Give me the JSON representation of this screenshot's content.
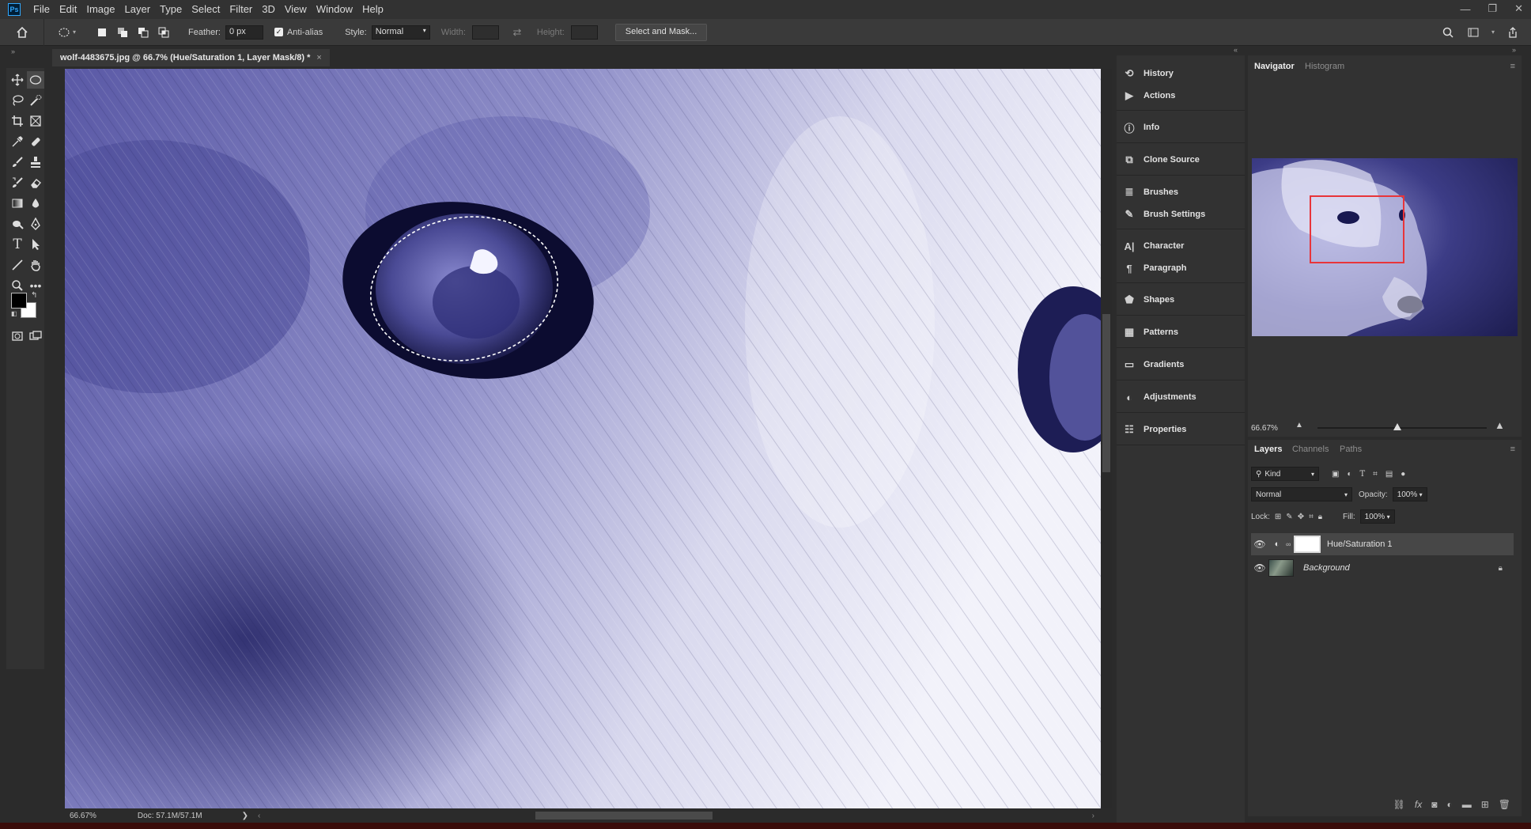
{
  "app": {
    "logo_text": "Ps"
  },
  "menu": [
    "File",
    "Edit",
    "Image",
    "Layer",
    "Type",
    "Select",
    "Filter",
    "3D",
    "View",
    "Window",
    "Help"
  ],
  "window_controls": {
    "minimize": "—",
    "restore": "❐",
    "close": "✕"
  },
  "options": {
    "feather_label": "Feather:",
    "feather_value": "0 px",
    "antialias_label": "Anti-alias",
    "antialias_checked": true,
    "style_label": "Style:",
    "style_value": "Normal",
    "width_label": "Width:",
    "height_label": "Height:",
    "select_mask_label": "Select and Mask..."
  },
  "document": {
    "tab_title": "wolf-4483675.jpg @ 66.7% (Hue/Saturation 1, Layer Mask/8) *",
    "close_glyph": "×",
    "zoom": "66.67%",
    "doc_size": "Doc: 57.1M/57.1M",
    "status_arrow": "❯",
    "status_left": "‹",
    "status_right": "›"
  },
  "panel_strip": [
    {
      "label": "History",
      "icon": "history-icon"
    },
    {
      "label": "Actions",
      "icon": "play-icon"
    },
    {
      "label": "Info",
      "icon": "info-icon"
    },
    {
      "label": "Clone Source",
      "icon": "clone-source-icon"
    },
    {
      "label": "Brushes",
      "icon": "brushes-icon"
    },
    {
      "label": "Brush Settings",
      "icon": "brush-settings-icon"
    },
    {
      "label": "Character",
      "icon": "character-icon"
    },
    {
      "label": "Paragraph",
      "icon": "paragraph-icon"
    },
    {
      "label": "Shapes",
      "icon": "shapes-icon"
    },
    {
      "label": "Patterns",
      "icon": "patterns-icon"
    },
    {
      "label": "Gradients",
      "icon": "gradients-icon"
    },
    {
      "label": "Adjustments",
      "icon": "adjustments-icon"
    },
    {
      "label": "Properties",
      "icon": "properties-icon"
    }
  ],
  "navigator": {
    "tabs": [
      "Navigator",
      "Histogram"
    ],
    "active_tab": "Navigator",
    "zoom": "66.67%",
    "zoom_slider_fraction": 0.47
  },
  "layers_panel": {
    "tabs": [
      "Layers",
      "Channels",
      "Paths"
    ],
    "active_tab": "Layers",
    "filter_value": "Kind",
    "blend_mode": "Normal",
    "opacity_label": "Opacity:",
    "opacity_value": "100%",
    "lock_label": "Lock:",
    "fill_label": "Fill:",
    "fill_value": "100%",
    "layers": [
      {
        "name": "Hue/Saturation 1",
        "visible": true,
        "selected": true,
        "locked": false
      },
      {
        "name": "Background",
        "visible": true,
        "selected": false,
        "locked": true
      }
    ]
  },
  "colors": {
    "image_tint": "#5b5ba8",
    "accent_red": "#e8353a",
    "panel_bg": "#323232"
  }
}
